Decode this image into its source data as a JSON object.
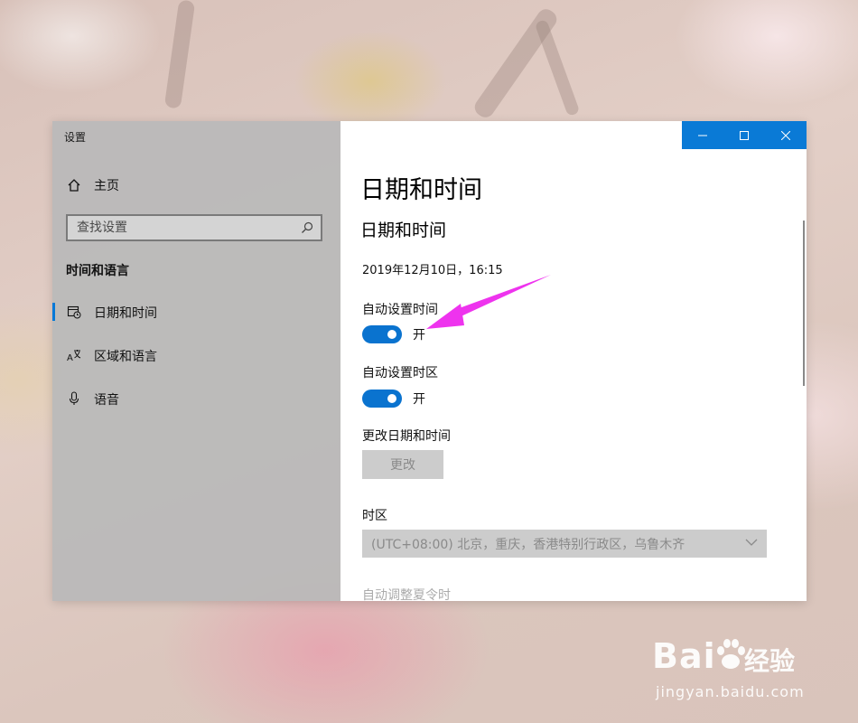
{
  "window": {
    "title": "设置"
  },
  "sidebar": {
    "home_label": "主页",
    "search_placeholder": "查找设置",
    "section_header": "时间和语言",
    "items": [
      {
        "label": "日期和时间",
        "icon": "calendar-clock-icon",
        "active": true
      },
      {
        "label": "区域和语言",
        "icon": "language-icon",
        "active": false
      },
      {
        "label": "语音",
        "icon": "microphone-icon",
        "active": false
      }
    ]
  },
  "main": {
    "page_title": "日期和时间",
    "section_title": "日期和时间",
    "current_datetime": "2019年12月10日，16:15",
    "auto_time": {
      "label": "自动设置时间",
      "state": "开",
      "on": true
    },
    "auto_timezone": {
      "label": "自动设置时区",
      "state": "开",
      "on": true
    },
    "change_datetime": {
      "label": "更改日期和时间",
      "button": "更改"
    },
    "timezone": {
      "label": "时区",
      "value": "(UTC+08:00) 北京，重庆，香港特别行政区，乌鲁木齐"
    },
    "dst_label": "自动调整夏令时"
  },
  "watermark": {
    "logo_text": "Bai",
    "logo_suffix": "经验",
    "url": "jingyan.baidu.com"
  },
  "colors": {
    "accent": "#0078d7",
    "toggle_on": "#0a73cf",
    "arrow": "#ee33ee"
  }
}
